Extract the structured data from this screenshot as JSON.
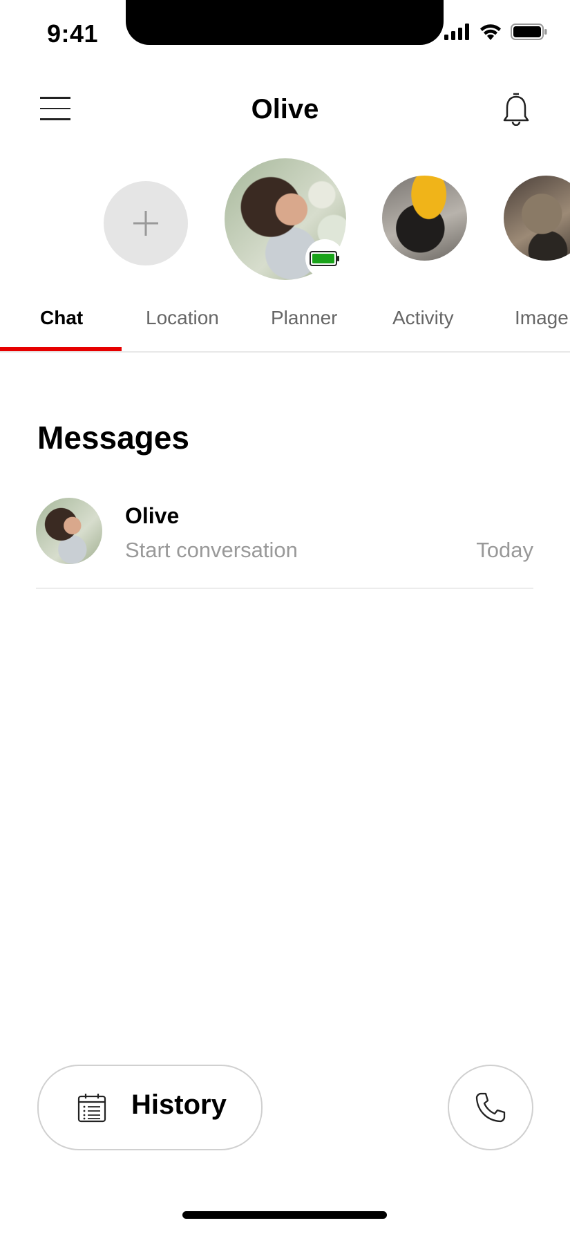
{
  "status_bar": {
    "time": "9:41"
  },
  "header": {
    "title": "Olive"
  },
  "tabs": [
    {
      "label": "Chat",
      "active": true
    },
    {
      "label": "Location",
      "active": false
    },
    {
      "label": "Planner",
      "active": false
    },
    {
      "label": "Activity",
      "active": false
    },
    {
      "label": "Image",
      "active": false
    }
  ],
  "messages": {
    "title": "Messages",
    "items": [
      {
        "name": "Olive",
        "preview": "Start conversation",
        "time": "Today"
      }
    ]
  },
  "bottom_bar": {
    "history_label": "History"
  },
  "colors": {
    "accent": "#e60000",
    "battery": "#1aa31a"
  }
}
